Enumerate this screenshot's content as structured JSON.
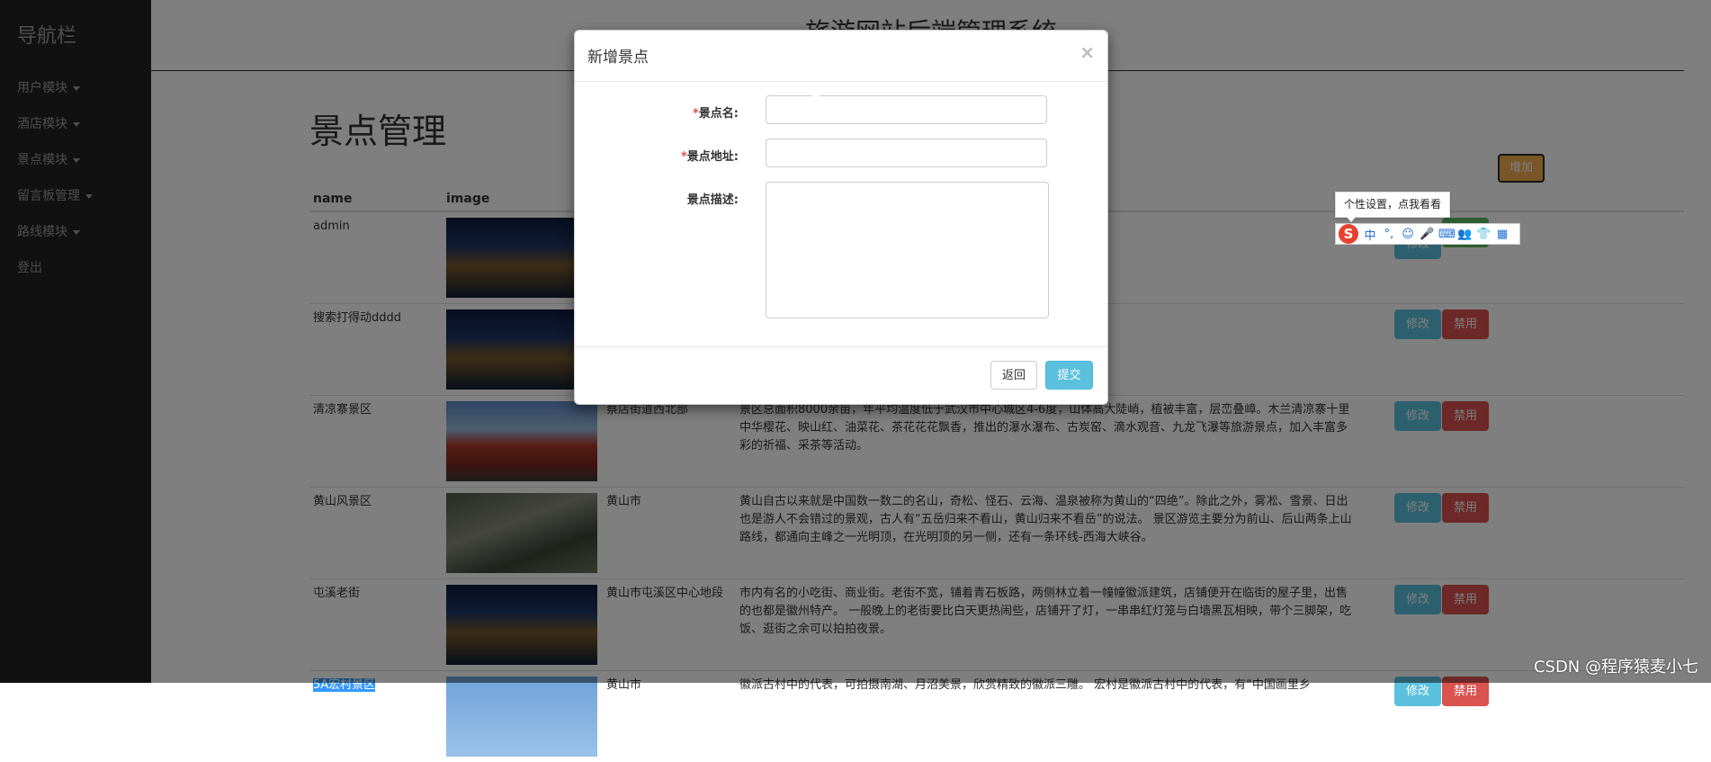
{
  "sidebar": {
    "brand": "导航栏",
    "items": [
      {
        "label": "用户模块"
      },
      {
        "label": "酒店模块"
      },
      {
        "label": "景点模块"
      },
      {
        "label": "留言板管理"
      },
      {
        "label": "路线模块"
      },
      {
        "label": "登出"
      }
    ]
  },
  "header": {
    "title": "旅游网站后端管理系统"
  },
  "page": {
    "title": "景点管理",
    "add_label": "增加"
  },
  "table": {
    "columns": [
      "name",
      "image"
    ],
    "rows": [
      {
        "name": "admin",
        "address": "",
        "desc": ""
      },
      {
        "name": "搜索打得动dddd",
        "address": "",
        "desc": ""
      },
      {
        "name": "清凉寨景区",
        "address": "蔡店街道西北部",
        "desc": "景区总面积8000余亩，年平均温度低于武汉市中心城区4-6度，山体高大陡峭，植被丰富，层峦叠嶂。木兰清凉寨十里中华樱花、映山红、油菜花、茶花花花飘香，推出的瀑水瀑布、古炭窑、滴水观音、九龙飞瀑等旅游景点，加入丰富多彩的祈福、采茶等活动。"
      },
      {
        "name": "黄山风景区",
        "address": "黄山市",
        "desc": "黄山自古以来就是中国数一数二的名山，奇松、怪石、云海、温泉被称为黄山的“四绝”。除此之外，雾凇、雪景、日出也是游人不会错过的景观，古人有“五岳归来不看山，黄山归来不看岳”的说法。 景区游览主要分为前山、后山两条上山路线，都通向主峰之一光明顶，在光明顶的另一侧，还有一条环线-西海大峡谷。"
      },
      {
        "name": "屯溪老街",
        "address": "黄山市屯溪区中心地段",
        "desc": "市内有名的小吃街、商业街。老街不宽，铺着青石板路，两侧林立着一幢幢徽派建筑，店铺便开在临街的屋子里，出售的也都是徽州特产。 一般晚上的老街要比白天更热闹些，店铺开了灯，一串串红灯笼与白墙黑瓦相映，带个三脚架，吃饭、逛街之余可以拍拍夜景。"
      },
      {
        "name": "5A宏村景区",
        "address": "黄山市",
        "desc": "徽派古村中的代表，可拍摄南湖、月沼美景，欣赏精致的徽派三雕。 宏村是徽派古村中的代表，有“中国画里乡"
      }
    ],
    "edit_label": "修改",
    "ban_label": "禁用"
  },
  "modal": {
    "title": "新增景点",
    "close": "×",
    "fields": {
      "name_label": "景点名:",
      "address_label": "景点地址:",
      "desc_label": "景点描述:",
      "required_mark": "*"
    },
    "back_label": "返回",
    "submit_label": "提交"
  },
  "ime": {
    "tooltip": "个性设置，点我看看",
    "logo": "S",
    "icons": [
      "中",
      "°,",
      "☺",
      "🎤",
      "⌨",
      "👥",
      "👕",
      "▦"
    ]
  },
  "watermark": "CSDN @程序猿麦小七"
}
